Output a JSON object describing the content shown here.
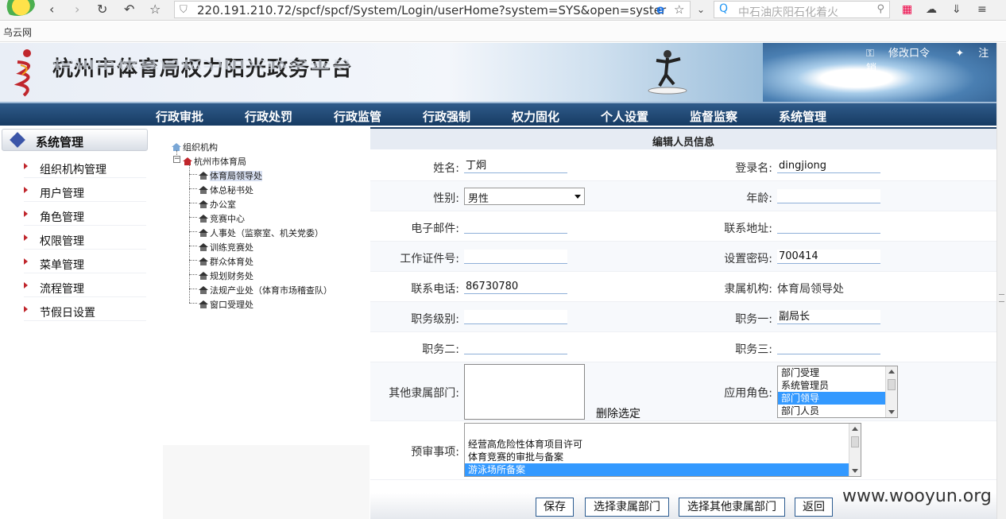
{
  "browser": {
    "url": "220.191.210.72/spcf/spcf/System/Login/userHome?system=SYS&open=syster",
    "search_text": "中石油庆阳石化着火",
    "bookmark": "乌云网"
  },
  "header": {
    "title": "杭州市体育局权力阳光政务平台",
    "change_password": "修改口令",
    "logout": "注 销"
  },
  "main_menu": [
    "行政审批",
    "行政处罚",
    "行政监管",
    "行政强制",
    "权力固化",
    "个人设置",
    "监督监察",
    "系统管理"
  ],
  "sidebar": {
    "heading": "系统管理",
    "items": [
      "组织机构管理",
      "用户管理",
      "角色管理",
      "权限管理",
      "菜单管理",
      "流程管理",
      "节假日设置"
    ]
  },
  "tree": {
    "root": "组织机构",
    "org": "杭州市体育局",
    "children": [
      "体育局领导处",
      "体总秘书处",
      "办公室",
      "竞赛中心",
      "人事处（监察室、机关党委）",
      "训练竞赛处",
      "群众体育处",
      "规划财务处",
      "法规产业处（体育市场稽查队）",
      "窗口受理处"
    ]
  },
  "form": {
    "title": "编辑人员信息",
    "labels": {
      "name": "姓名:",
      "login": "登录名:",
      "gender": "性别:",
      "age": "年龄:",
      "email": "电子邮件:",
      "address": "联系地址:",
      "cert": "工作证件号:",
      "password": "设置密码:",
      "phone": "联系电话:",
      "org": "隶属机构:",
      "rank": "职务级别:",
      "duty1": "职务一:",
      "duty2": "职务二:",
      "duty3": "职务三:",
      "other_dept": "其他隶属部门:",
      "roles": "应用角色:",
      "pre_review": "预审事项:"
    },
    "values": {
      "name": "丁炯",
      "login": "dingjiong",
      "gender": "男性",
      "age": "",
      "email": "",
      "address": "",
      "cert": "",
      "password": "700414",
      "phone": "86730780",
      "org": "体育局领导处",
      "rank": "",
      "duty1": "副局长",
      "duty2": "",
      "duty3": ""
    },
    "delete_selected": "删除选定",
    "roles": [
      "部门受理",
      "系统管理员",
      "部门领导",
      "部门人员"
    ],
    "pre_review_items": [
      "经营高危险性体育项目许可",
      "体育竞赛的审批与备案",
      "游泳场所备案"
    ],
    "buttons": {
      "save": "保存",
      "choose_dept": "选择隶属部门",
      "choose_other": "选择其他隶属部门",
      "back": "返回"
    }
  },
  "watermark": "www.wooyun.org",
  "colors": {
    "menu_bg": "#1f4470",
    "selection": "#3399ff",
    "accent_red": "#c0262c"
  }
}
